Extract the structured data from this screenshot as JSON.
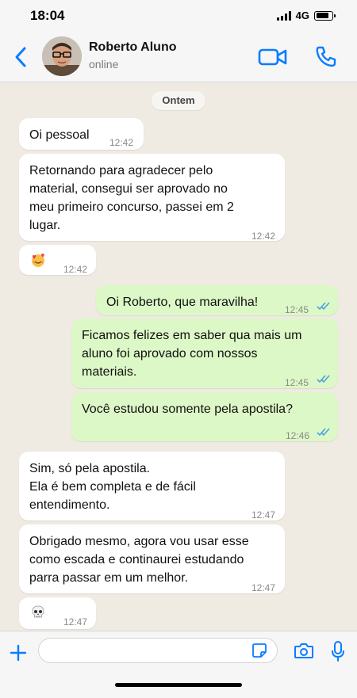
{
  "status_bar": {
    "time": "18:04",
    "network": "4G",
    "battery_level": 0.8
  },
  "header": {
    "contact_name": "Roberto Aluno",
    "contact_status": "online"
  },
  "chat": {
    "date_divider": "Ontem",
    "messages": [
      {
        "direction": "incoming",
        "text": "Oi pessoal",
        "time": "12:42"
      },
      {
        "direction": "incoming",
        "text": "Retornando para agradecer pelo\nmaterial, consegui ser aprovado no\nmeu primeiro concurso, passei em 2\nlugar.",
        "time": "12:42"
      },
      {
        "direction": "incoming",
        "emoji": "smiling-face-with-hearts-emoji",
        "time": "12:42"
      },
      {
        "direction": "outgoing",
        "text": "Oi Roberto, que maravilha!",
        "time": "12:45",
        "status": "read"
      },
      {
        "direction": "outgoing",
        "text": "Ficamos felizes em saber qua mais um\naluno foi aprovado com nossos\nmateriais.",
        "time": "12:45",
        "status": "read"
      },
      {
        "direction": "outgoing",
        "text": "Você estudou somente pela apostila?",
        "time": "12:46",
        "status": "read"
      },
      {
        "direction": "incoming",
        "text": "Sim, só pela apostila.\nEla é bem completa e de fácil\nentendimento.",
        "time": "12:47"
      },
      {
        "direction": "incoming",
        "text": "Obrigado mesmo, agora vou usar esse\ncomo escada e continaurei estudando\nparra passar em um melhor.",
        "time": "12:47"
      },
      {
        "direction": "incoming",
        "emoji": "skull-emoji",
        "time": "12:47"
      }
    ]
  },
  "composer": {
    "placeholder": ""
  },
  "colors": {
    "accent": "#0a7cff",
    "outgoing_bubble": "#dcf8c6",
    "incoming_bubble": "#ffffff",
    "read_ticks": "#4aa3df",
    "chat_background": "#efeae2"
  }
}
